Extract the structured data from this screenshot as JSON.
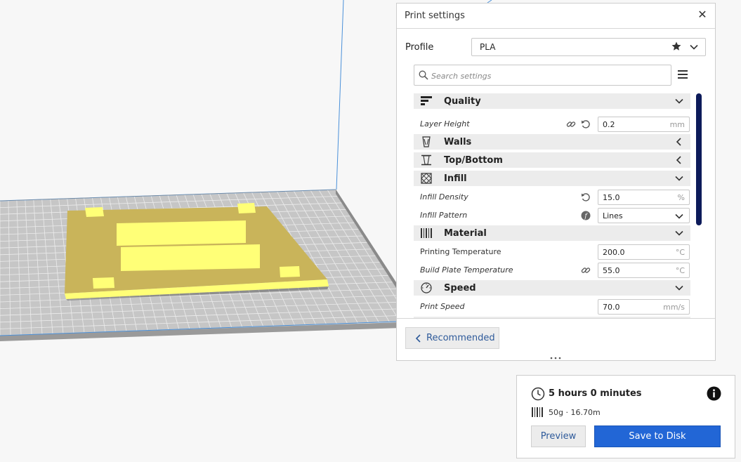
{
  "print_settings": {
    "title": "Print settings",
    "close_glyph": "✕",
    "profile_label": "Profile",
    "profile_value": "PLA",
    "search_placeholder": "Search settings",
    "categories": [
      {
        "label": "Quality",
        "icon": "quality-icon",
        "state": "expanded"
      },
      {
        "label": "Walls",
        "icon": "walls-icon",
        "state": "collapsed"
      },
      {
        "label": "Top/Bottom",
        "icon": "top-bottom-icon",
        "state": "collapsed"
      },
      {
        "label": "Infill",
        "icon": "infill-icon",
        "state": "expanded"
      },
      {
        "label": "Material",
        "icon": "material-icon",
        "state": "expanded"
      },
      {
        "label": "Speed",
        "icon": "speed-icon",
        "state": "expanded"
      }
    ],
    "settings": [
      {
        "label": "Layer Height",
        "value": "0.2",
        "unit": "mm"
      },
      {
        "label": "Infill Density",
        "value": "15.0",
        "unit": "%"
      },
      {
        "label": "Infill Pattern",
        "value": "Lines"
      },
      {
        "label": "Printing Temperature",
        "value": "200.0",
        "unit": "°C"
      },
      {
        "label": "Build Plate Temperature",
        "value": "55.0",
        "unit": "°C"
      },
      {
        "label": "Print Speed",
        "value": "70.0",
        "unit": "mm/s"
      }
    ],
    "recommended_label": "Recommended"
  },
  "summary": {
    "time": "5 hours 0 minutes",
    "material": "50g · 16.70m",
    "preview_label": "Preview",
    "save_label": "Save to Disk"
  },
  "colors": {
    "accent": "#2266d6",
    "scrollbar": "#0d1b5a",
    "model_yellow": "#ffff77",
    "model_gold": "#c9b45a",
    "build_plate": "#b8b8b8",
    "volume_edge": "#4a90d9"
  }
}
